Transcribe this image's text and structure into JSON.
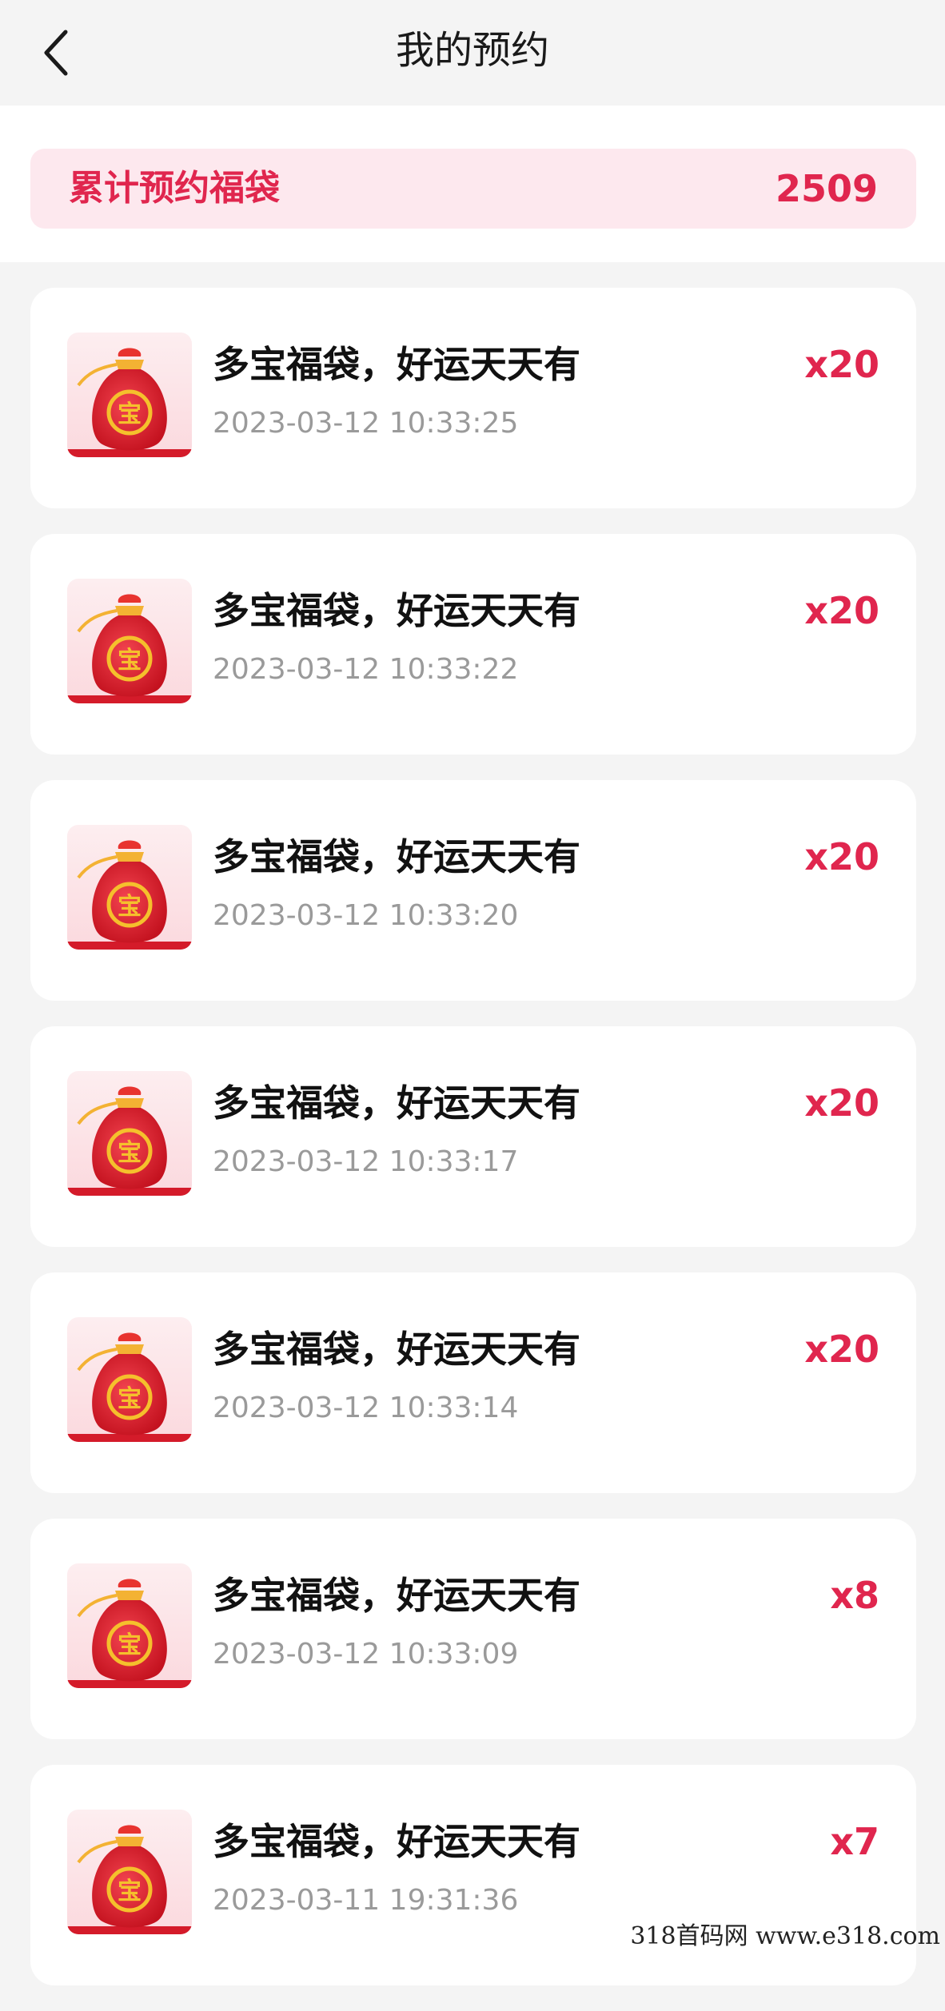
{
  "header": {
    "title": "我的预约"
  },
  "summary": {
    "label": "累计预约福袋",
    "value": "2509"
  },
  "items": [
    {
      "title": "多宝福袋，好运天天有",
      "time": "2023-03-12 10:33:25",
      "qty": "x20"
    },
    {
      "title": "多宝福袋，好运天天有",
      "time": "2023-03-12 10:33:22",
      "qty": "x20"
    },
    {
      "title": "多宝福袋，好运天天有",
      "time": "2023-03-12 10:33:20",
      "qty": "x20"
    },
    {
      "title": "多宝福袋，好运天天有",
      "time": "2023-03-12 10:33:17",
      "qty": "x20"
    },
    {
      "title": "多宝福袋，好运天天有",
      "time": "2023-03-12 10:33:14",
      "qty": "x20"
    },
    {
      "title": "多宝福袋，好运天天有",
      "time": "2023-03-12 10:33:09",
      "qty": "x8"
    },
    {
      "title": "多宝福袋，好运天天有",
      "time": "2023-03-11 19:31:36",
      "qty": "x7"
    }
  ],
  "thumb_char": "宝",
  "watermark": "318首码网   www.e318.com",
  "colors": {
    "accent": "#e0264e",
    "summary_bg": "#fde8ee",
    "page_bg": "#f4f4f4"
  }
}
